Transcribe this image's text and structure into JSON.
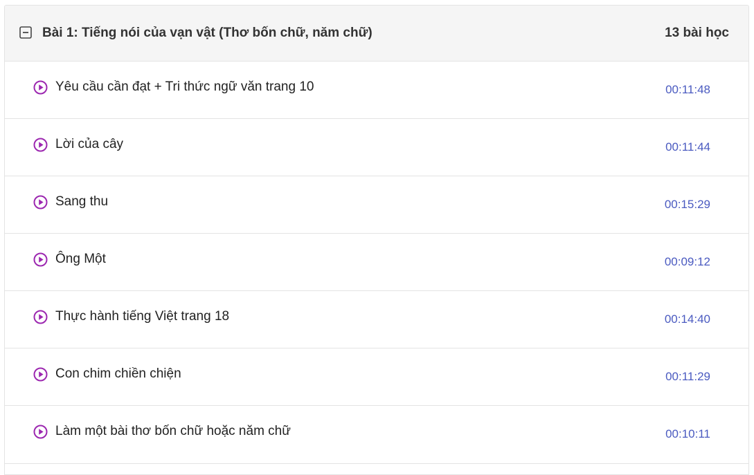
{
  "section": {
    "title": "Bài 1: Tiếng nói của vạn vật (Thơ bốn chữ, năm chữ)",
    "lesson_count": "13 bài học",
    "collapse_icon": "minus-square-icon",
    "play_icon": "play-circle-icon"
  },
  "colors": {
    "accent_play": "#9c27b0",
    "duration_text": "#4a5ac0",
    "header_bg": "#f5f5f5"
  },
  "lessons": [
    {
      "title": "Yêu cầu cần đạt + Tri thức ngữ văn trang 10",
      "duration": "00:11:48"
    },
    {
      "title": "Lời của cây",
      "duration": "00:11:44"
    },
    {
      "title": "Sang thu",
      "duration": "00:15:29"
    },
    {
      "title": "Ông Một",
      "duration": "00:09:12"
    },
    {
      "title": "Thực hành tiếng Việt trang 18",
      "duration": "00:14:40"
    },
    {
      "title": "Con chim chiền chiện",
      "duration": "00:11:29"
    },
    {
      "title": "Làm một bài thơ bốn chữ hoặc năm chữ",
      "duration": "00:10:11"
    }
  ]
}
